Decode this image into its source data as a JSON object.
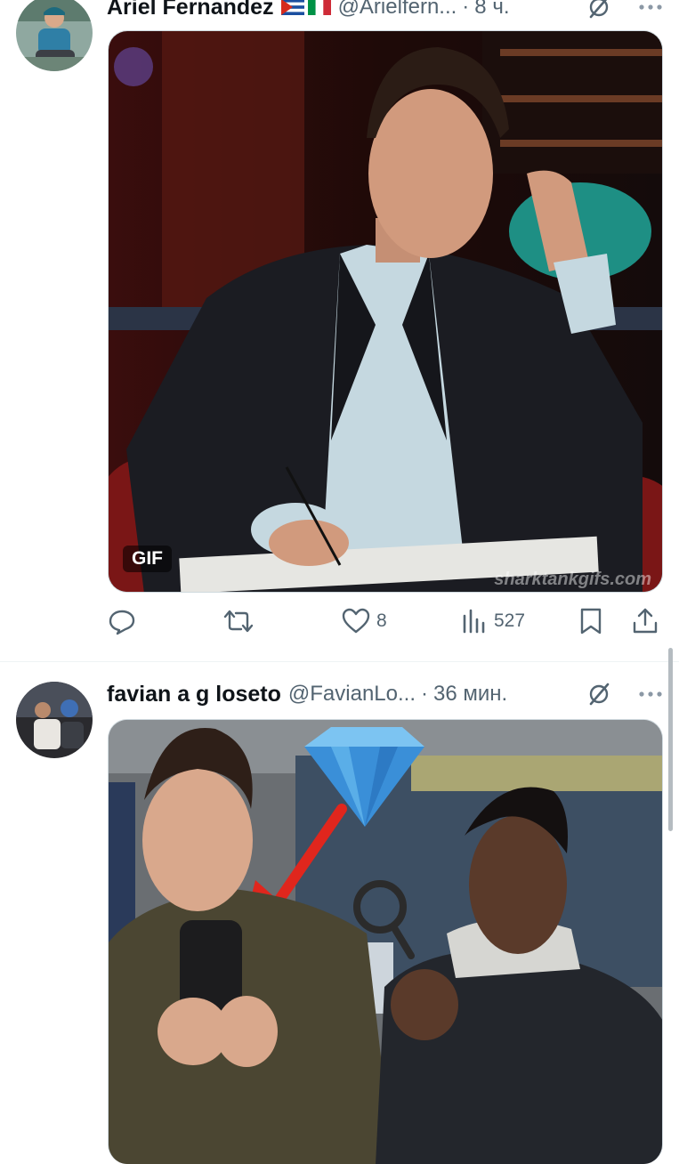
{
  "tweets": [
    {
      "author_name": "Ariel Fernandez",
      "handle": "@Arielfern...",
      "separator": "·",
      "time": "8 ч.",
      "media": {
        "type": "gif",
        "badge": "GIF",
        "watermark": "sharktankgifs.com"
      },
      "actions": {
        "reply_count": "",
        "retweet_count": "",
        "like_count": "8",
        "views_count": "527"
      }
    },
    {
      "author_name": "favian a g loseto",
      "handle": "@FavianLo...",
      "separator": "·",
      "time": "36 мин.",
      "media": {
        "type": "image"
      }
    }
  ],
  "colors": {
    "text_primary": "#0f1419",
    "text_secondary": "#536471",
    "divider": "#eff3f4",
    "gem_blue": "#4aa8e8",
    "arrow_red": "#e0261d"
  },
  "icons": [
    "grok-icon",
    "more-icon",
    "reply-icon",
    "retweet-icon",
    "like-icon",
    "views-icon",
    "bookmark-icon",
    "share-icon"
  ]
}
